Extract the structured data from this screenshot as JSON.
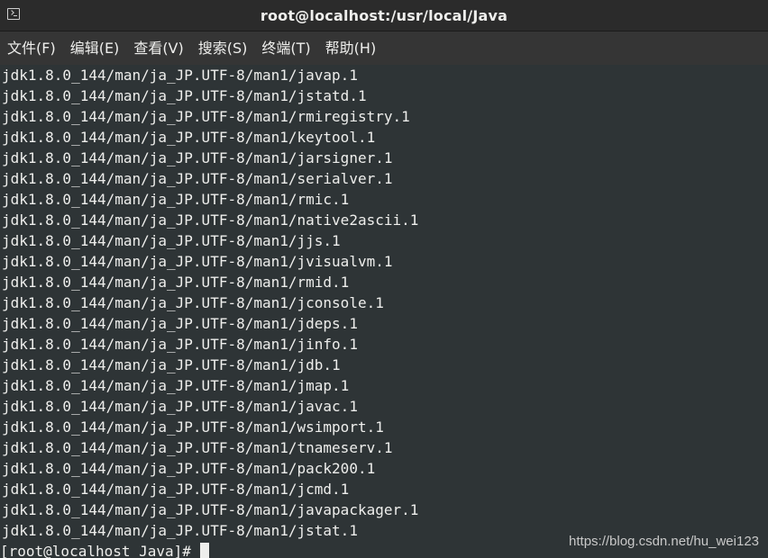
{
  "window": {
    "title": "root@localhost:/usr/local/Java"
  },
  "menu": [
    {
      "label": "文件(F)"
    },
    {
      "label": "编辑(E)"
    },
    {
      "label": "查看(V)"
    },
    {
      "label": "搜索(S)"
    },
    {
      "label": "终端(T)"
    },
    {
      "label": "帮助(H)"
    }
  ],
  "terminal": {
    "lines": [
      "jdk1.8.0_144/man/ja_JP.UTF-8/man1/javap.1",
      "jdk1.8.0_144/man/ja_JP.UTF-8/man1/jstatd.1",
      "jdk1.8.0_144/man/ja_JP.UTF-8/man1/rmiregistry.1",
      "jdk1.8.0_144/man/ja_JP.UTF-8/man1/keytool.1",
      "jdk1.8.0_144/man/ja_JP.UTF-8/man1/jarsigner.1",
      "jdk1.8.0_144/man/ja_JP.UTF-8/man1/serialver.1",
      "jdk1.8.0_144/man/ja_JP.UTF-8/man1/rmic.1",
      "jdk1.8.0_144/man/ja_JP.UTF-8/man1/native2ascii.1",
      "jdk1.8.0_144/man/ja_JP.UTF-8/man1/jjs.1",
      "jdk1.8.0_144/man/ja_JP.UTF-8/man1/jvisualvm.1",
      "jdk1.8.0_144/man/ja_JP.UTF-8/man1/rmid.1",
      "jdk1.8.0_144/man/ja_JP.UTF-8/man1/jconsole.1",
      "jdk1.8.0_144/man/ja_JP.UTF-8/man1/jdeps.1",
      "jdk1.8.0_144/man/ja_JP.UTF-8/man1/jinfo.1",
      "jdk1.8.0_144/man/ja_JP.UTF-8/man1/jdb.1",
      "jdk1.8.0_144/man/ja_JP.UTF-8/man1/jmap.1",
      "jdk1.8.0_144/man/ja_JP.UTF-8/man1/javac.1",
      "jdk1.8.0_144/man/ja_JP.UTF-8/man1/wsimport.1",
      "jdk1.8.0_144/man/ja_JP.UTF-8/man1/tnameserv.1",
      "jdk1.8.0_144/man/ja_JP.UTF-8/man1/pack200.1",
      "jdk1.8.0_144/man/ja_JP.UTF-8/man1/jcmd.1",
      "jdk1.8.0_144/man/ja_JP.UTF-8/man1/javapackager.1",
      "jdk1.8.0_144/man/ja_JP.UTF-8/man1/jstat.1"
    ],
    "prompt": "[root@localhost Java]#"
  },
  "watermark": "https://blog.csdn.net/hu_wei123",
  "colors": {
    "background": "#2e3436",
    "foreground": "#eeeeec",
    "titlebar": "#2b2b2b",
    "menubar": "#353535"
  },
  "icons": {
    "window_icon": "terminal-icon"
  }
}
